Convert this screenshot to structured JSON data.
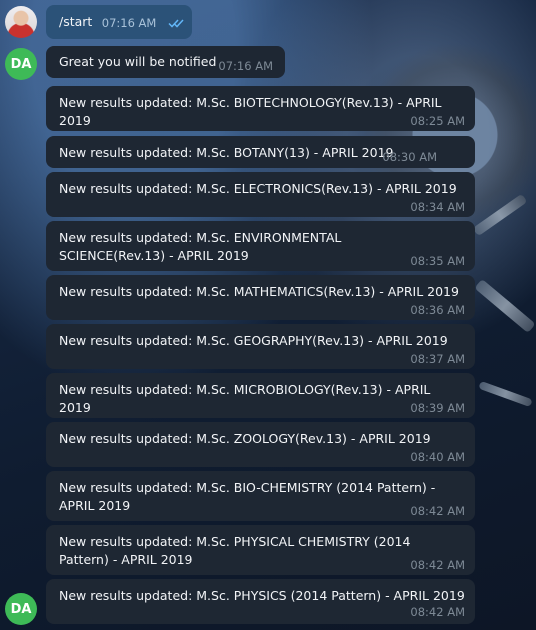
{
  "chat": {
    "outgoing": {
      "text": "/start",
      "time": "07:16 AM",
      "status_icon": "double-check-icon"
    },
    "avatars": {
      "bot_initials": "DA"
    },
    "messages": [
      {
        "text": "Great you will be notified",
        "time": "07:16 AM"
      },
      {
        "text": "New results updated: M.Sc. BIOTECHNOLOGY(Rev.13) - APRIL 2019",
        "time": "08:25 AM"
      },
      {
        "text": "New results updated: M.Sc. BOTANY(13) - APRIL 2019",
        "time": "08:30 AM"
      },
      {
        "text": "New results updated: M.Sc. ELECTRONICS(Rev.13) - APRIL 2019",
        "time": "08:34 AM"
      },
      {
        "text": "New results updated: M.Sc. ENVIRONMENTAL SCIENCE(Rev.13) - APRIL 2019",
        "time": "08:35 AM"
      },
      {
        "text": "New results updated: M.Sc. MATHEMATICS(Rev.13) - APRIL 2019",
        "time": "08:36 AM"
      },
      {
        "text": "New results updated: M.Sc. GEOGRAPHY(Rev.13) - APRIL 2019",
        "time": "08:37 AM"
      },
      {
        "text": "New results updated: M.Sc. MICROBIOLOGY(Rev.13) - APRIL 2019",
        "time": "08:39 AM"
      },
      {
        "text": "New results updated: M.Sc. ZOOLOGY(Rev.13) - APRIL 2019",
        "time": "08:40 AM"
      },
      {
        "text": "New results updated: M.Sc. BIO-CHEMISTRY (2014 Pattern) - APRIL 2019",
        "time": "08:42 AM"
      },
      {
        "text": "New results updated: M.Sc. PHYSICAL CHEMISTRY (2014 Pattern) - APRIL 2019",
        "time": "08:42 AM"
      },
      {
        "text": "New results updated: M.Sc. PHYSICS (2014 Pattern) - APRIL 2019",
        "time": "08:42 AM"
      }
    ]
  }
}
